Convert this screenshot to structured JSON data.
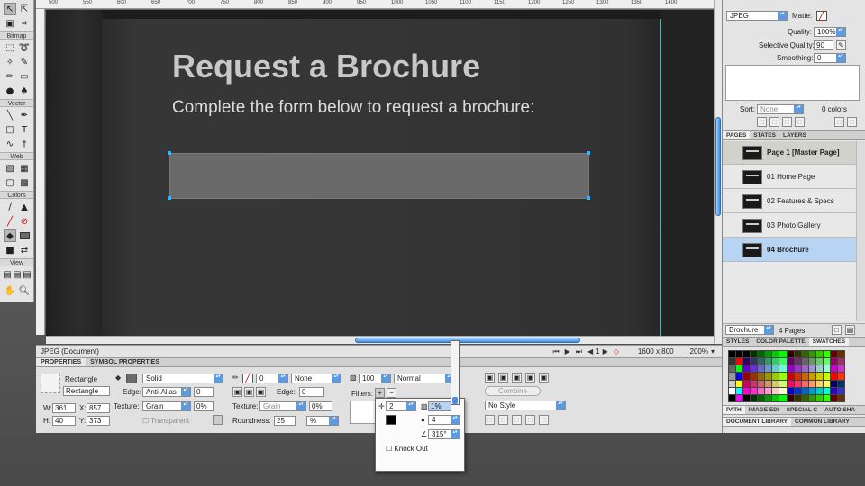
{
  "tools": {
    "sections": [
      "Bitmap",
      "Vector",
      "Web",
      "Colors",
      "View"
    ],
    "icons": {
      "select": [
        "pointer-icon",
        "subselect-icon"
      ],
      "select2": [
        "scale-icon",
        "crop-icon"
      ],
      "bitmap": [
        "marquee-icon",
        "lasso-icon",
        "magic-wand-icon",
        "brush-icon",
        "pencil-icon",
        "eraser-icon",
        "blur-icon",
        "rubber-stamp-icon"
      ],
      "vector": [
        "line-icon",
        "pen-icon",
        "rectangle-icon",
        "text-icon",
        "freeform-icon",
        "knife-icon"
      ],
      "web": [
        "hotspot-icon",
        "slice-icon",
        "hide-slices-icon",
        "show-slices-icon"
      ],
      "colors": [
        "eyedropper-icon",
        "paint-bucket-icon",
        "stroke-color-icon",
        "fill-color-icon"
      ],
      "view": [
        "standard-mode-icon",
        "full-screen-menu-icon",
        "full-screen-icon",
        "hand-icon",
        "zoom-icon"
      ]
    }
  },
  "ruler": {
    "start": "500",
    "ticks": [
      "500",
      "550",
      "600",
      "650",
      "700",
      "750",
      "800",
      "850",
      "900",
      "950",
      "1000",
      "1050",
      "1100",
      "1150",
      "1200",
      "1250",
      "1300",
      "1350",
      "1400"
    ]
  },
  "canvas": {
    "headline": "Request a Brochure",
    "subline": "Complete the form below to request a brochure:"
  },
  "status": {
    "doc_type": "JPEG (Document)",
    "page_num": "1",
    "dims": "1600 x 800",
    "zoom": "200%"
  },
  "props": {
    "tabs": [
      "PROPERTIES",
      "SYMBOL PROPERTIES"
    ],
    "object_type": "Rectangle",
    "object_name": "Rectangle",
    "w_label": "W:",
    "w": "361",
    "h_label": "H:",
    "h": "40",
    "x_label": "X:",
    "x": "857",
    "y_label": "Y:",
    "y": "373",
    "fill_type": "Solid",
    "edge_label": "Edge:",
    "edge": "Anti-Alias",
    "edge_val": "0",
    "texture_label": "Texture:",
    "texture": "Grain",
    "texture_pct": "0%",
    "transparent_label": "Transparent",
    "stroke_size": "0",
    "stroke_type": "None",
    "stroke_edge_label": "Edge:",
    "stroke_edge_val": "0",
    "stroke_texture_label": "Texture:",
    "stroke_texture": "Grain",
    "stroke_texture_pct": "0%",
    "roundness_label": "Roundness:",
    "roundness": "25",
    "roundness_unit": "%",
    "opacity": "100",
    "blend": "Normal",
    "filters_label": "Filters:",
    "combine_label": "Combine",
    "style": "No Style"
  },
  "popup": {
    "distance": "2",
    "opacity": "1%",
    "softness": "4",
    "angle": "315°",
    "knockout_label": "Knock Out"
  },
  "optimize": {
    "format": "JPEG",
    "matte_label": "Matte:",
    "quality_label": "Quality:",
    "quality": "100%",
    "selective_label": "Selective Quality:",
    "selective": "90",
    "smoothing_label": "Smoothing:",
    "smoothing": "0",
    "sort_label": "Sort:",
    "sort": "None",
    "colors": "0 colors"
  },
  "pages_panel": {
    "tabs": [
      "PAGES",
      "STATES",
      "LAYERS"
    ],
    "pages": [
      {
        "label": "Page 1 [Master Page]"
      },
      {
        "label": "01  Home Page"
      },
      {
        "label": "02  Features & Specs"
      },
      {
        "label": "03  Photo Gallery"
      },
      {
        "label": "04  Brochure"
      }
    ],
    "footer_page": "Brochure",
    "footer_count": "4 Pages"
  },
  "swatch_panel": {
    "tabs": [
      "STYLES",
      "COLOR PALETTE",
      "SWATCHES"
    ]
  },
  "path_panel": {
    "tabs": [
      "PATH",
      "IMAGE EDI",
      "SPECIAL C",
      "AUTO SHA"
    ]
  },
  "library_panel": {
    "tabs": [
      "DOCUMENT LIBRARY",
      "COMMON LIBRARY"
    ]
  },
  "colors": {
    "accent": "#3b8de0",
    "selection": "#b8d4f4",
    "guide": "#3fc0c0",
    "handle": "#2fb8ff"
  }
}
